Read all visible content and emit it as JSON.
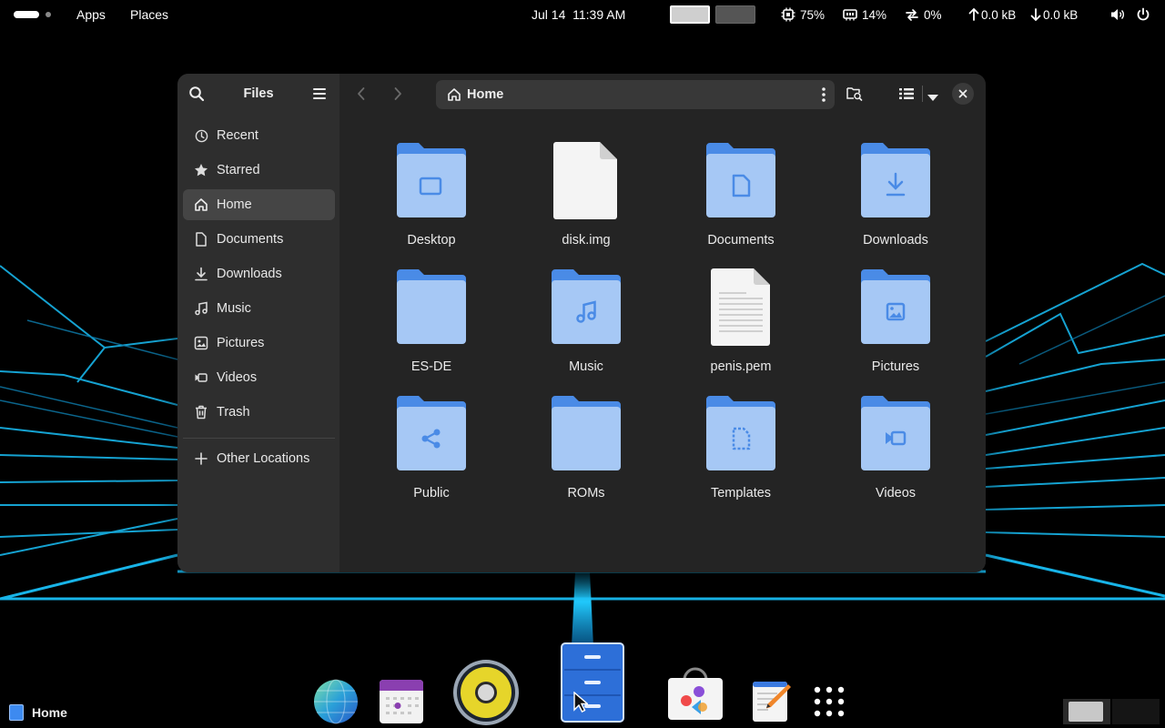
{
  "topbar": {
    "apps_label": "Apps",
    "places_label": "Places",
    "datetime": "Jul 14  11:39 AM",
    "cpu": "75%",
    "memory": "14%",
    "swap": "0%",
    "net_up": "0.0 kB",
    "net_down": "0.0 kB"
  },
  "window": {
    "sidebar_title": "Files",
    "sidebar": [
      {
        "label": "Recent",
        "icon": "clock-icon"
      },
      {
        "label": "Starred",
        "icon": "star-icon"
      },
      {
        "label": "Home",
        "icon": "home-icon",
        "active": true
      },
      {
        "label": "Documents",
        "icon": "document-icon"
      },
      {
        "label": "Downloads",
        "icon": "download-icon"
      },
      {
        "label": "Music",
        "icon": "music-icon"
      },
      {
        "label": "Pictures",
        "icon": "picture-icon"
      },
      {
        "label": "Videos",
        "icon": "video-icon"
      },
      {
        "label": "Trash",
        "icon": "trash-icon"
      }
    ],
    "other_locations": "Other Locations",
    "path": "Home",
    "files": [
      {
        "name": "Desktop",
        "type": "folder",
        "emblem": "desktop"
      },
      {
        "name": "disk.img",
        "type": "blank-file"
      },
      {
        "name": "Documents",
        "type": "folder",
        "emblem": "document"
      },
      {
        "name": "Downloads",
        "type": "folder",
        "emblem": "download"
      },
      {
        "name": "ES-DE",
        "type": "folder",
        "emblem": "none"
      },
      {
        "name": "Music",
        "type": "folder",
        "emblem": "music"
      },
      {
        "name": "penis.pem",
        "type": "text-file"
      },
      {
        "name": "Pictures",
        "type": "folder",
        "emblem": "picture"
      },
      {
        "name": "Public",
        "type": "folder",
        "emblem": "share"
      },
      {
        "name": "ROMs",
        "type": "folder",
        "emblem": "none"
      },
      {
        "name": "Templates",
        "type": "folder",
        "emblem": "template"
      },
      {
        "name": "Videos",
        "type": "folder",
        "emblem": "video"
      }
    ]
  },
  "dock": {
    "apps": [
      "web-browser-icon",
      "calendar-icon",
      "speaker-icon",
      "file-manager-icon",
      "software-store-icon",
      "text-editor-icon",
      "app-grid-icon"
    ]
  },
  "taskbar": {
    "window_label": "Home"
  },
  "colors": {
    "folder_light": "#a6c8f5",
    "folder_tab": "#4a8be6",
    "emblem": "#4a8be6",
    "accent_cyan": "#20c8f0"
  }
}
